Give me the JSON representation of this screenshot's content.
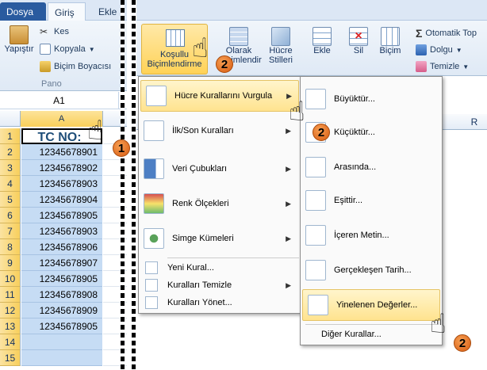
{
  "tabs": {
    "file": "Dosya",
    "home": "Giriş",
    "insert": "Ekle"
  },
  "clipboard": {
    "paste": "Yapıştır",
    "cut": "Kes",
    "copy": "Kopyala",
    "painter": "Biçim Boyacısı",
    "group": "Pano"
  },
  "namebox": "A1",
  "columns": {
    "a": "A",
    "r": "R"
  },
  "rows": [
    "1",
    "2",
    "3",
    "4",
    "5",
    "6",
    "7",
    "8",
    "9",
    "10",
    "11",
    "12",
    "13",
    "14",
    "15"
  ],
  "cells": [
    "TC NO:",
    "12345678901",
    "12345678902",
    "12345678903",
    "12345678904",
    "12345678905",
    "12345678903",
    "12345678906",
    "12345678907",
    "12345678905",
    "12345678908",
    "12345678909",
    "12345678905",
    "",
    ""
  ],
  "ribbon": {
    "cf_line1": "Koşullu",
    "cf_line2": "Biçimlendirme",
    "table_line1": "Olarak",
    "table_line2": "Biçimlendir",
    "cell_line1": "Hücre",
    "cell_line2": "Stilleri",
    "insert": "Ekle",
    "delete": "Sil",
    "format": "Biçim",
    "autosum": "Otomatik Top",
    "fill": "Dolgu",
    "clear": "Temizle"
  },
  "menu1": {
    "items": [
      "Hücre Kurallarını Vurgula",
      "İlk/Son Kuralları",
      "Veri Çubukları",
      "Renk Ölçekleri",
      "Simge Kümeleri"
    ],
    "small": [
      "Yeni Kural...",
      "Kuralları Temizle",
      "Kuralları Yönet..."
    ]
  },
  "menu2": {
    "items": [
      "Büyüktür...",
      "Küçüktür...",
      "Arasında...",
      "Eşittir...",
      "İçeren Metin...",
      "Gerçekleşen Tarih...",
      "Yinelenen Değerler..."
    ],
    "more": "Diğer Kurallar..."
  },
  "badges": [
    "1",
    "2",
    "2",
    "2"
  ],
  "colors": {
    "accent": "#ffd257",
    "file_tab": "#2a5b9f",
    "selection": "#c6dcf4",
    "badge": "#e06a18"
  }
}
